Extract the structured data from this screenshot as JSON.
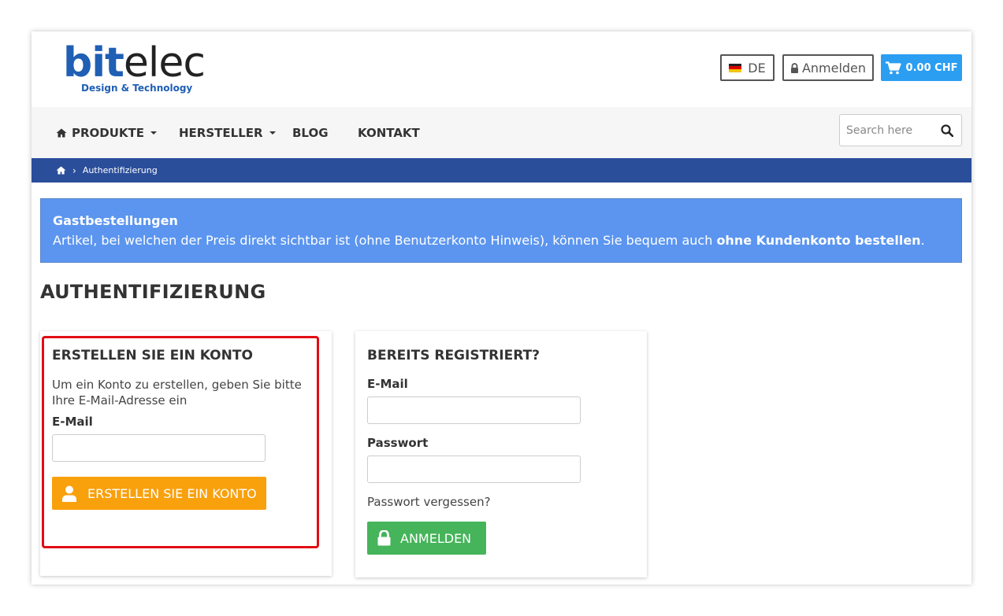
{
  "brand": {
    "logo_main_bold": "bit",
    "logo_main_light": "elec",
    "logo_tagline": "Design & Technology",
    "primary_color": "#1f5fb4"
  },
  "header": {
    "language": "DE",
    "login_label": "Anmelden",
    "cart_total": "0.00 CHF",
    "cart_color": "#2b9ef2"
  },
  "nav": {
    "items": [
      "PRODUKTE",
      "HERSTELLER",
      "BLOG",
      "KONTAKT"
    ],
    "search_placeholder": "Search here"
  },
  "breadcrumb": {
    "current": "Authentifizierung",
    "bar_color": "#2b4e9b"
  },
  "alert": {
    "title": "Gastbestellungen",
    "text_before": "Artikel, bei welchen der Preis direkt sichtbar ist (ohne Benutzerkonto Hinweis), können Sie bequem auch ",
    "text_bold": "ohne Kundenkonto bestellen",
    "text_after": ".",
    "color": "#5b95ef"
  },
  "page_title": "AUTHENTIFIZIERUNG",
  "create_account": {
    "title": "ERSTELLEN SIE EIN KONTO",
    "description": "Um ein Konto zu erstellen, geben Sie bitte Ihre E-Mail-Adresse ein",
    "email_label": "E-Mail",
    "email_value": "",
    "button_label": "ERSTELLEN SIE EIN KONTO",
    "button_color": "#f9a00d",
    "highlight_color": "#e20d14"
  },
  "login": {
    "title": "BEREITS REGISTRIERT?",
    "email_label": "E-Mail",
    "email_value": "",
    "password_label": "Passwort",
    "password_value": "",
    "forgot_label": "Passwort vergessen?",
    "button_label": "ANMELDEN",
    "button_color": "#45b45a"
  }
}
